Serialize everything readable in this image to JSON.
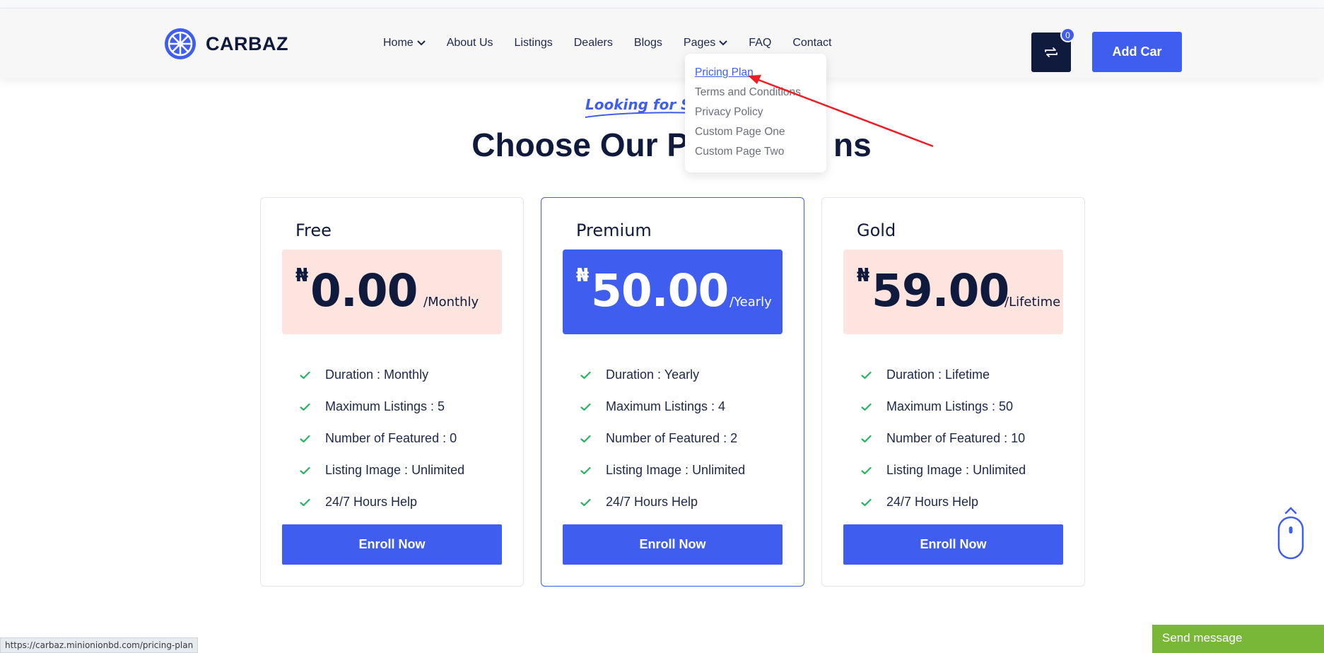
{
  "header": {
    "brand": "CARBAZ",
    "nav": [
      {
        "label": "Home",
        "has_dropdown": true
      },
      {
        "label": "About Us",
        "has_dropdown": false
      },
      {
        "label": "Listings",
        "has_dropdown": false
      },
      {
        "label": "Dealers",
        "has_dropdown": false
      },
      {
        "label": "Blogs",
        "has_dropdown": false
      },
      {
        "label": "Pages",
        "has_dropdown": true
      },
      {
        "label": "FAQ",
        "has_dropdown": false
      },
      {
        "label": "Contact",
        "has_dropdown": false
      }
    ],
    "compare_count": "0",
    "add_car_label": "Add Car"
  },
  "pages_dropdown": {
    "items": [
      "Pricing Plan",
      "Terms and Conditions",
      "Privacy Policy",
      "Custom Page One",
      "Custom Page Two"
    ],
    "active_index": 0
  },
  "section": {
    "subtitle": "Looking for Su",
    "title": "Choose Our Pricing Plans",
    "title_visible": "Choose Our P",
    "title_tail": "ns"
  },
  "plans": [
    {
      "name": "Free",
      "currency": "₦",
      "price": "0.00",
      "period": "/Monthly",
      "featured": false,
      "features": [
        "Duration : Monthly",
        "Maximum Listings : 5",
        "Number of Featured : 0",
        "Listing Image : Unlimited",
        "24/7 Hours Help"
      ],
      "button": "Enroll Now"
    },
    {
      "name": "Premium",
      "currency": "₦",
      "price": "50.00",
      "period": "/Yearly",
      "featured": true,
      "features": [
        "Duration : Yearly",
        "Maximum Listings : 4",
        "Number of Featured : 2",
        "Listing Image : Unlimited",
        "24/7 Hours Help"
      ],
      "button": "Enroll Now"
    },
    {
      "name": "Gold",
      "currency": "₦",
      "price": "59.00",
      "period": "/Lifetime",
      "featured": false,
      "features": [
        "Duration : Lifetime",
        "Maximum Listings : 50",
        "Number of Featured : 10",
        "Listing Image : Unlimited",
        "24/7 Hours Help"
      ],
      "button": "Enroll Now"
    }
  ],
  "status_bar_url": "https://carbaz.minionionbd.com/pricing-plan",
  "chat": {
    "label": "Send message"
  },
  "colors": {
    "accent": "#3f5ef0",
    "navy": "#0f1a3d",
    "price_bg": "#fde4df",
    "check": "#28b363",
    "chat": "#78b737",
    "annotation": "#ee1c25"
  }
}
